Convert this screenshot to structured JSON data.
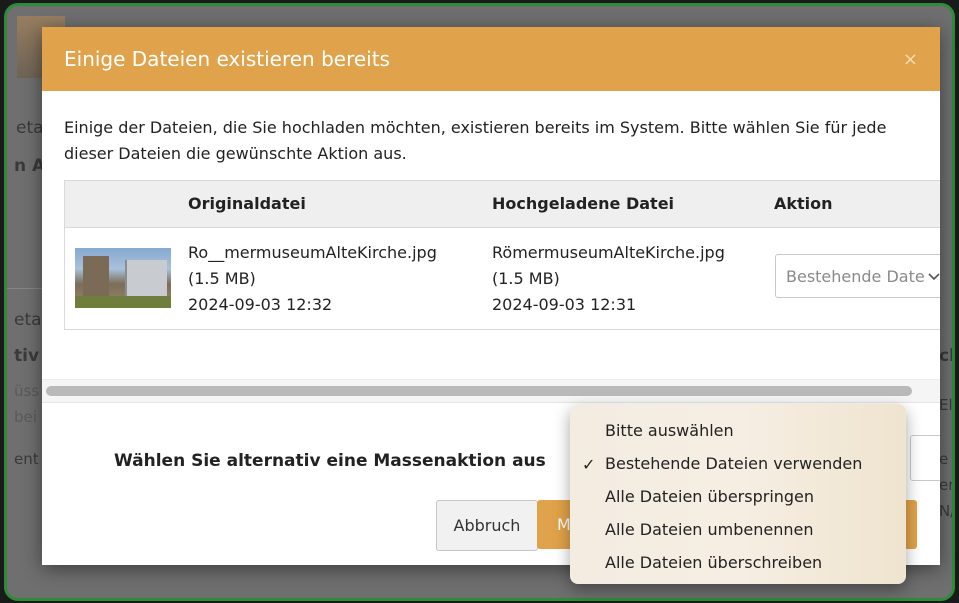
{
  "background": {
    "fragments": [
      "eta",
      "n A",
      "eta",
      "tiv",
      "üss",
      "bei",
      "ent",
      "ch",
      "Ele",
      "e",
      "er",
      "N/"
    ]
  },
  "dialog": {
    "title": "Einige Dateien existieren bereits",
    "close_icon": "×",
    "intro": "Einige der Dateien, die Sie hochladen möchten, existieren bereits im System. Bitte wählen Sie für jede dieser Dateien die gewünschte Aktion aus.",
    "columns": {
      "original": "Originaldatei",
      "uploaded": "Hochgeladene Datei",
      "action": "Aktion"
    },
    "rows": [
      {
        "original_name": "Ro__mermuseumAlteKirche.jpg",
        "original_size": "(1.5 MB)",
        "original_date": "2024-09-03 12:32",
        "uploaded_name": "RömermuseumAlteKirche.jpg",
        "uploaded_size": "(1.5 MB)",
        "uploaded_date": "2024-09-03 12:31",
        "action_value": "Bestehende Dateien verwenden"
      }
    ],
    "mass_action_label": "Wählen Sie alternativ eine Massenaktion aus",
    "cancel_label": "Abbruch",
    "primary_label": "M",
    "dropdown_options": [
      {
        "label": "Bitte auswählen",
        "checked": false
      },
      {
        "label": "Bestehende Dateien verwenden",
        "checked": true
      },
      {
        "label": "Alle Dateien überspringen",
        "checked": false
      },
      {
        "label": "Alle Dateien umbenennen",
        "checked": false
      },
      {
        "label": "Alle Dateien überschreiben",
        "checked": false
      }
    ],
    "check_mark": "✓"
  },
  "colors": {
    "header": "#e0a24a",
    "frame": "#2f8b3a"
  }
}
